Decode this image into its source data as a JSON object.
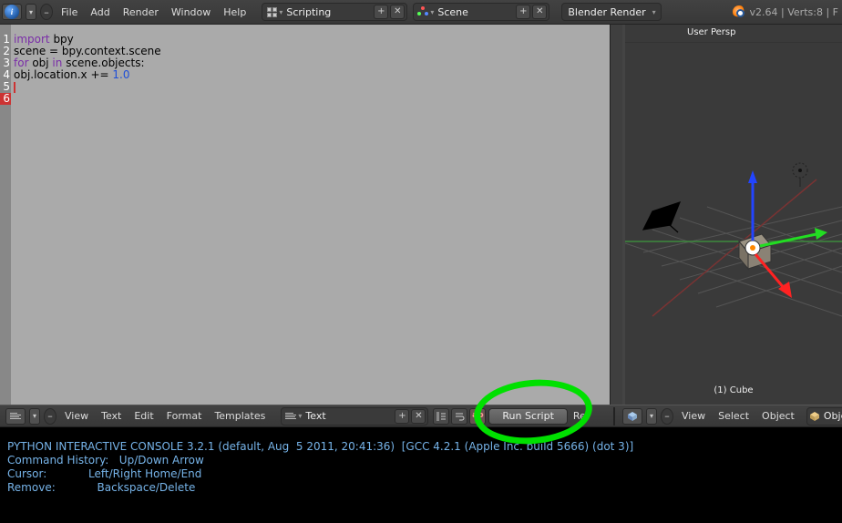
{
  "top_header": {
    "menus": [
      "File",
      "Add",
      "Render",
      "Window",
      "Help"
    ],
    "layout_field": "Scripting",
    "scene_field": "Scene",
    "engine_field": "Blender Render",
    "version": "v2.64",
    "stats": "Verts:8",
    "divider": "|"
  },
  "code": {
    "lines": [
      "1",
      "2",
      "3",
      "4",
      "5",
      "6"
    ],
    "l1_kw": "import",
    "l1_rest": " bpy",
    "l2": "",
    "l3_a": "scene ",
    "l3_eq": "=",
    "l3_b": " bpy.context.scene",
    "l4_kw1": "for",
    "l4_a": " obj ",
    "l4_kw2": "in",
    "l4_b": " scene.objects:",
    "l5_a": "    obj.location.x ",
    "l5_op": "+=",
    "l5_sp": " ",
    "l5_num": "1.0"
  },
  "viewport": {
    "label": "User Persp",
    "object": "(1) Cube"
  },
  "text_header": {
    "menus": [
      "View",
      "Text",
      "Edit",
      "Format",
      "Templates"
    ],
    "name_field": "Text",
    "run_btn": "Run Script",
    "re_btn": "Re"
  },
  "view_header": {
    "menus": [
      "View",
      "Select",
      "Object"
    ],
    "mode": "Obje"
  },
  "console": {
    "l1": "PYTHON INTERACTIVE CONSOLE 3.2.1 (default, Aug  5 2011, 20:41:36)  [GCC 4.2.1 (Apple Inc. build 5666) (dot 3)]",
    "l2": "",
    "l3": "Command History:   Up/Down Arrow",
    "l4": "Cursor:            Left/Right Home/End",
    "l5": "Remove:            Backspace/Delete"
  }
}
